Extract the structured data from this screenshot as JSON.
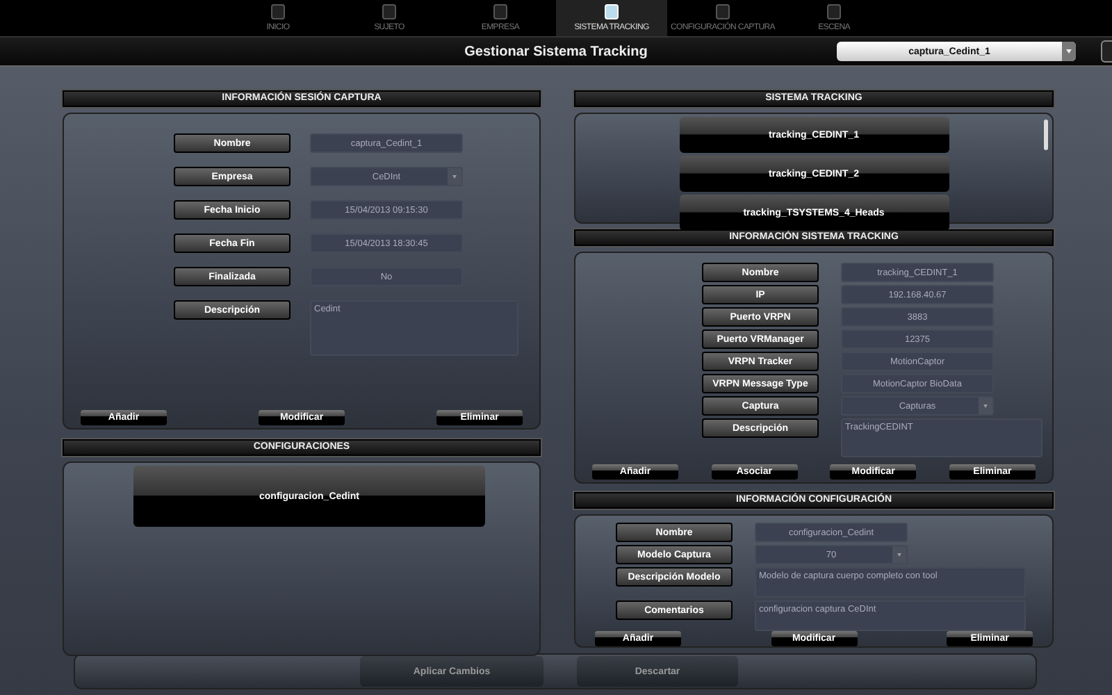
{
  "nav_tabs": [
    {
      "label": "INICIO",
      "selected": false
    },
    {
      "label": "SUJETO",
      "selected": false
    },
    {
      "label": "EMPRESA",
      "selected": false
    },
    {
      "label": "SISTEMA TRACKING",
      "selected": true
    },
    {
      "label": "CONFIGURACIÓN CAPTURA",
      "selected": false
    },
    {
      "label": "ESCENA",
      "selected": false
    }
  ],
  "title": "Gestionar Sistema Tracking",
  "session_select": {
    "value": "captura_Cedint_1"
  },
  "session_info": {
    "title": "INFORMACIÓN SESIÓN CAPTURA",
    "fields": [
      {
        "label": "Nombre",
        "kind": "text",
        "value": "captura_Cedint_1"
      },
      {
        "label": "Empresa",
        "kind": "select",
        "value": "CeDInt"
      },
      {
        "label": "Fecha Inicio",
        "kind": "text",
        "value": "15/04/2013 09:15:30"
      },
      {
        "label": "Fecha Fin",
        "kind": "text",
        "value": "15/04/2013 18:30:45"
      },
      {
        "label": "Finalizada",
        "kind": "text",
        "value": "No"
      },
      {
        "label": "Descripción",
        "kind": "textarea",
        "value": "Cedint"
      }
    ],
    "buttons": [
      "Añadir",
      "Modificar",
      "Eliminar"
    ]
  },
  "configurations": {
    "title": "CONFIGURACIONES",
    "items": [
      "configuracion_Cedint"
    ]
  },
  "tracking_systems": {
    "title": "SISTEMA TRACKING",
    "items": [
      "tracking_CEDINT_1",
      "tracking_CEDINT_2",
      "tracking_TSYSTEMS_4_Heads"
    ]
  },
  "tracking_info": {
    "title": "INFORMACIÓN SISTEMA TRACKING",
    "fields": [
      {
        "label": "Nombre",
        "kind": "text",
        "value": "tracking_CEDINT_1"
      },
      {
        "label": "IP",
        "kind": "text",
        "value": "192.168.40.67"
      },
      {
        "label": "Puerto VRPN",
        "kind": "text",
        "value": "3883"
      },
      {
        "label": "Puerto VRManager",
        "kind": "text",
        "value": "12375"
      },
      {
        "label": "VRPN Tracker",
        "kind": "text",
        "value": "MotionCaptor"
      },
      {
        "label": "VRPN Message Type",
        "kind": "text",
        "value": "MotionCaptor BioData"
      },
      {
        "label": "Captura",
        "kind": "select",
        "value": "Capturas"
      },
      {
        "label": "Descripción",
        "kind": "textarea",
        "value": "TrackingCEDINT"
      }
    ],
    "buttons": [
      "Añadir",
      "Asociar",
      "Modificar",
      "Eliminar"
    ]
  },
  "config_info": {
    "title": "INFORMACIÓN CONFIGURACIÓN",
    "fields": [
      {
        "label": "Nombre",
        "kind": "text",
        "value": "configuracion_Cedint"
      },
      {
        "label": "Modelo Captura",
        "kind": "select",
        "value": "70"
      },
      {
        "label": "Descripción Modelo",
        "kind": "textarea",
        "value": "Modelo de captura cuerpo completo con tool"
      },
      {
        "label": "Comentarios",
        "kind": "textarea",
        "value": "configuracion captura CeDInt"
      }
    ],
    "buttons": [
      "Añadir",
      "Modificar",
      "Eliminar"
    ]
  },
  "footer_buttons": [
    "Aplicar Cambios",
    "Descartar"
  ]
}
